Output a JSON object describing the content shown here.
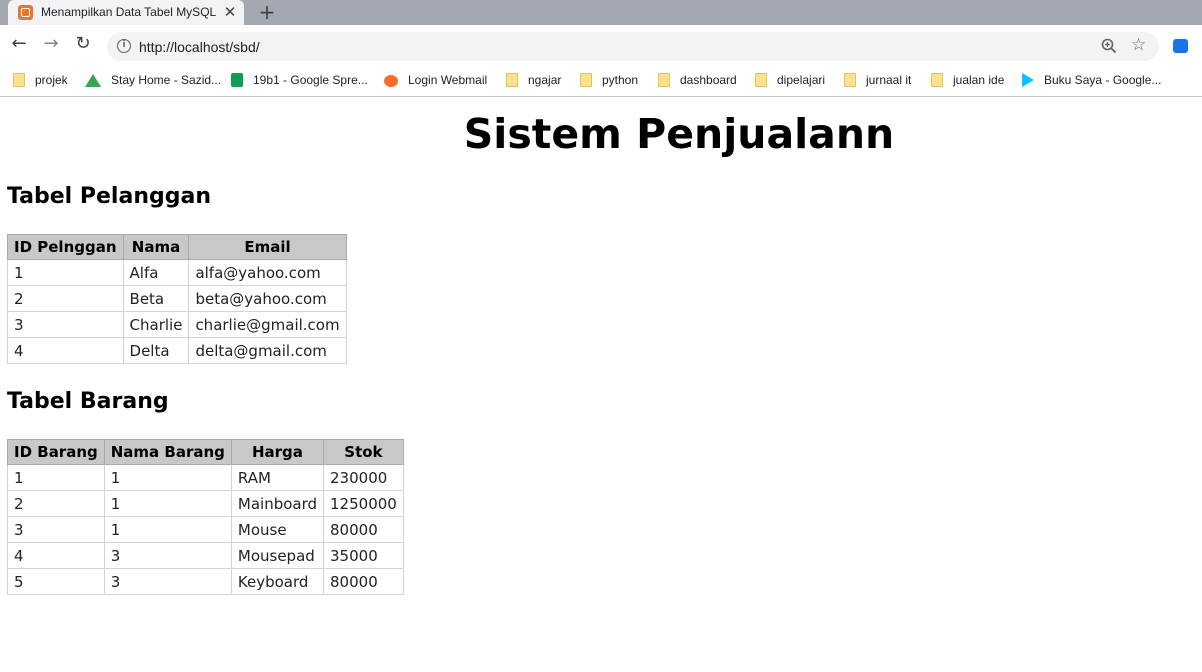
{
  "browser": {
    "tab_title": "Menampilkan Data Tabel MySQL",
    "tab_close": "✕",
    "new_tab": "+",
    "url": "http://localhost/sbd/",
    "bookmarks": [
      {
        "label": "projek",
        "icon": "folder-icon"
      },
      {
        "label": "Stay Home - Sazid...",
        "icon": "google-drive-icon"
      },
      {
        "label": "19b1 - Google Spre...",
        "icon": "google-sheets-icon"
      },
      {
        "label": "Login Webmail",
        "icon": "cpanel-icon"
      },
      {
        "label": "ngajar",
        "icon": "folder-icon"
      },
      {
        "label": "python",
        "icon": "folder-icon"
      },
      {
        "label": "dashboard",
        "icon": "folder-icon"
      },
      {
        "label": "dipelajari",
        "icon": "folder-icon"
      },
      {
        "label": "jurnaal it",
        "icon": "folder-icon"
      },
      {
        "label": "jualan ide",
        "icon": "folder-icon"
      },
      {
        "label": "Buku Saya - Google...",
        "icon": "google-play-icon"
      }
    ]
  },
  "page": {
    "title": "Sistem Penjualann",
    "pelanggan": {
      "heading": "Tabel Pelanggan",
      "headers": [
        "ID Pelnggan",
        "Nama",
        "Email"
      ],
      "rows": [
        [
          "1",
          "Alfa",
          "alfa@yahoo.com"
        ],
        [
          "2",
          "Beta",
          "beta@yahoo.com"
        ],
        [
          "3",
          "Charlie",
          "charlie@gmail.com"
        ],
        [
          "4",
          "Delta",
          "delta@gmail.com"
        ]
      ]
    },
    "barang": {
      "heading": "Tabel Barang",
      "headers": [
        "ID Barang",
        "Nama Barang",
        "Harga",
        "Stok"
      ],
      "rows": [
        [
          "1",
          "1",
          "RAM",
          "230000"
        ],
        [
          "2",
          "1",
          "Mainboard",
          "1250000"
        ],
        [
          "3",
          "1",
          "Mouse",
          "80000"
        ],
        [
          "4",
          "3",
          "Mousepad",
          "35000"
        ],
        [
          "5",
          "3",
          "Keyboard",
          "80000"
        ]
      ]
    }
  }
}
